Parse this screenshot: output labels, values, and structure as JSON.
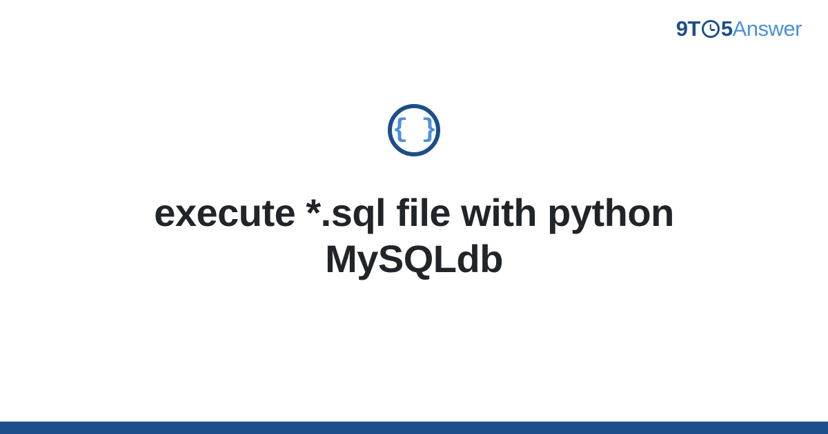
{
  "logo": {
    "part1": "9T",
    "part2": "5",
    "part3": "Answer"
  },
  "icon": {
    "glyph": "{ }",
    "name": "code-braces"
  },
  "title": "execute *.sql file with python MySQLdb",
  "colors": {
    "primary": "#1d4e89",
    "accent": "#4a90d9"
  }
}
